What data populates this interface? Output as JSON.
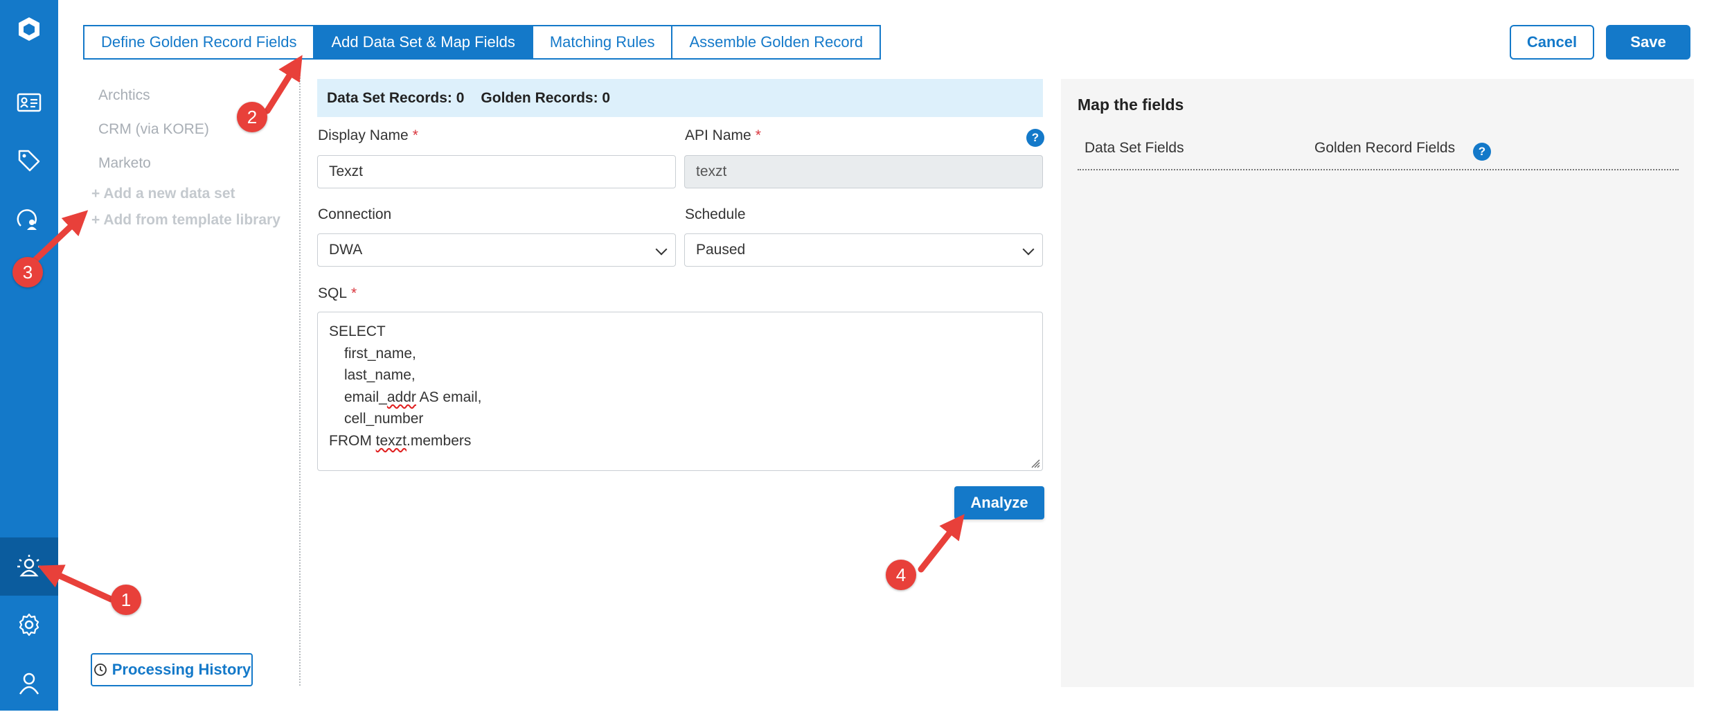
{
  "sidebar": {
    "items": [
      {
        "icon": "logo-cube-icon"
      },
      {
        "icon": "contact-card-icon"
      },
      {
        "icon": "tag-icon"
      },
      {
        "icon": "audience-icon"
      },
      {
        "icon": "golden-record-icon",
        "active": true
      },
      {
        "icon": "gear-icon"
      },
      {
        "icon": "user-icon"
      }
    ]
  },
  "tabs": [
    {
      "label": "Define Golden Record Fields",
      "active": false
    },
    {
      "label": "Add Data Set & Map Fields",
      "active": true
    },
    {
      "label": "Matching Rules",
      "active": false
    },
    {
      "label": "Assemble Golden Record",
      "active": false
    }
  ],
  "actions": {
    "cancel": "Cancel",
    "save": "Save"
  },
  "datasets": {
    "items": [
      "Archtics",
      "CRM (via KORE)",
      "Marketo"
    ],
    "add_new": "+ Add a new data set",
    "add_template": "+ Add from template library",
    "processing_history": "Processing History"
  },
  "stats": {
    "data_set_records": "Data Set Records: 0",
    "golden_records": "Golden Records: 0"
  },
  "form": {
    "display_name_label": "Display Name",
    "display_name_value": "Texzt",
    "api_name_label": "API Name",
    "api_name_value": "texzt",
    "required_mark": "*",
    "connection_label": "Connection",
    "connection_value": "DWA",
    "schedule_label": "Schedule",
    "schedule_value": "Paused",
    "sql_label": "SQL",
    "sql": {
      "select": "SELECT",
      "col1": "first_name,",
      "col2": "last_name,",
      "col3a": "email_",
      "col3b": "addr",
      "col3c": " AS email,",
      "col4": "cell_number",
      "from_a": "FROM ",
      "from_b": "texzt",
      "from_c": ".members"
    },
    "analyze": "Analyze",
    "help_glyph": "?"
  },
  "map": {
    "title": "Map the fields",
    "col_dataset": "Data Set Fields",
    "col_golden": "Golden Record Fields"
  },
  "annotations": {
    "b1": "1",
    "b2": "2",
    "b3": "3",
    "b4": "4"
  },
  "colors": {
    "brand": "#1479c9",
    "sidebar_active": "#0b5c9e",
    "annotation": "#e8403a",
    "stats_bg": "#ddf0fb",
    "panel_bg": "#f5f5f5"
  }
}
